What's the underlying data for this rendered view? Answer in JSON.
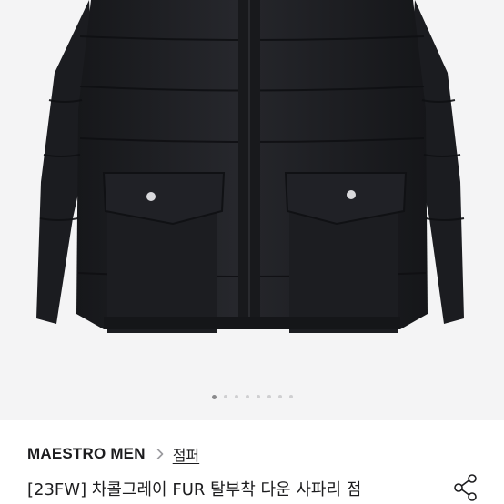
{
  "product": {
    "image_alt": "jacket-photo",
    "carousel": {
      "total": 8,
      "active_index": 0
    },
    "brand": "MAESTRO MEN",
    "category": "점퍼",
    "title": "[23FW] 차콜그레이 FUR 탈부착 다운 사파리 점"
  },
  "icons": {
    "breadcrumb_separator": "chevron-right-icon",
    "share": "share-icon"
  },
  "colors": {
    "text": "#1c1c1e",
    "image_bg": "#f4f4f5",
    "jacket": "#1e1f23",
    "dot_inactive": "#cfcfd1",
    "dot_active": "#8a8a8c"
  }
}
